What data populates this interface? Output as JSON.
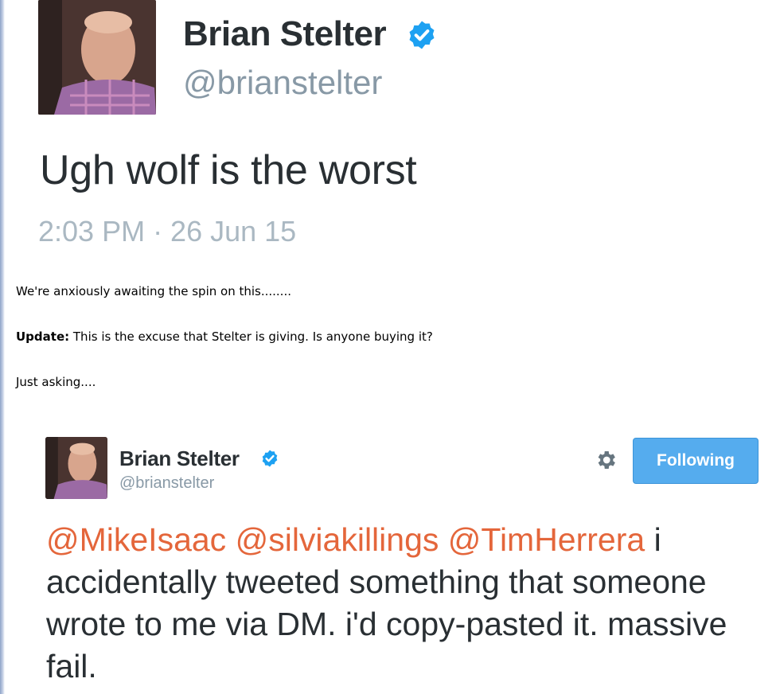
{
  "tweet_top": {
    "name": "Brian Stelter",
    "handle": "@brianstelter",
    "text": "Ugh wolf is the worst",
    "timestamp": "2:03 PM · 26 Jun 15"
  },
  "article": {
    "p1": "We're anxiously awaiting the spin on this........",
    "p2_label": "Update:",
    "p2_text": " This is the excuse that Stelter is giving. Is anyone buying it?",
    "p3": "Just asking...."
  },
  "tweet_embed": {
    "name": "Brian Stelter",
    "handle": "@brianstelter",
    "follow_label": "Following",
    "mentions": [
      "@MikeIsaac",
      "@silviakillings",
      "@TimHerrera"
    ],
    "text": " i accidentally tweeted something that someone wrote to me via DM. i'd copy-pasted it. massive fail."
  },
  "colors": {
    "verified": "#1da1f2",
    "mention": "#e4663b",
    "follow_button": "#55acee",
    "handle_gray": "#8899a6"
  },
  "icons": [
    "verified-badge-icon",
    "gear-icon",
    "avatar"
  ]
}
